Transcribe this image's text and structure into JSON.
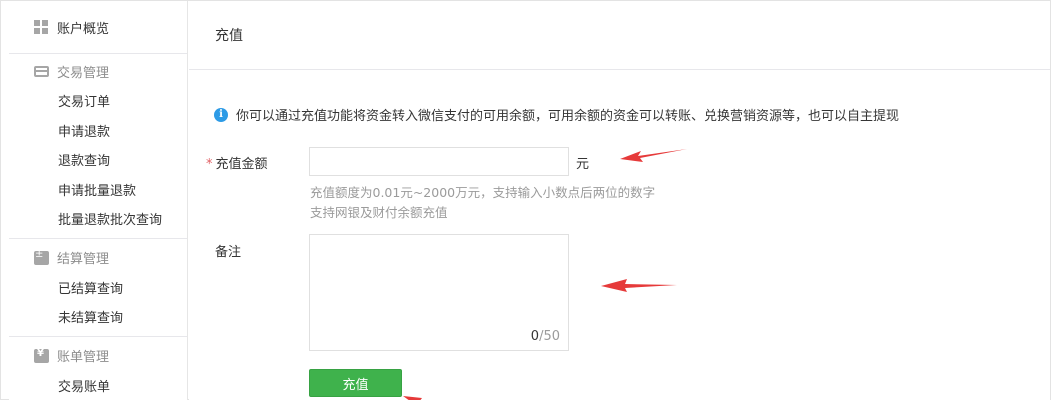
{
  "sidebar": {
    "overview": "账户概览",
    "groups": [
      {
        "title": "交易管理",
        "icon": "card-icon",
        "items": [
          "交易订单",
          "申请退款",
          "退款查询",
          "申请批量退款",
          "批量退款批次查询"
        ]
      },
      {
        "title": "结算管理",
        "icon": "calculator-icon",
        "items": [
          "已结算查询",
          "未结算查询"
        ]
      },
      {
        "title": "账单管理",
        "icon": "bill-icon",
        "items": [
          "交易账单"
        ]
      }
    ]
  },
  "main": {
    "title": "充值",
    "notice": "你可以通过充值功能将资金转入微信支付的可用余额，可用余额的资金可以转账、兑换营销资源等，也可以自主提现",
    "amount": {
      "required_mark": "*",
      "label": "充值金额",
      "value": "",
      "unit": "元",
      "hint1": "充值额度为0.01元~2000万元，支持输入小数点后两位的数字",
      "hint2": "支持网银及财付余额充值"
    },
    "remark": {
      "label": "备注",
      "value": "",
      "count": "0",
      "max": "/50"
    },
    "submit_label": "充值"
  },
  "colors": {
    "accent_green": "#3fb24c",
    "info_blue": "#2d9be6",
    "arrow_red": "#e63a3a"
  }
}
